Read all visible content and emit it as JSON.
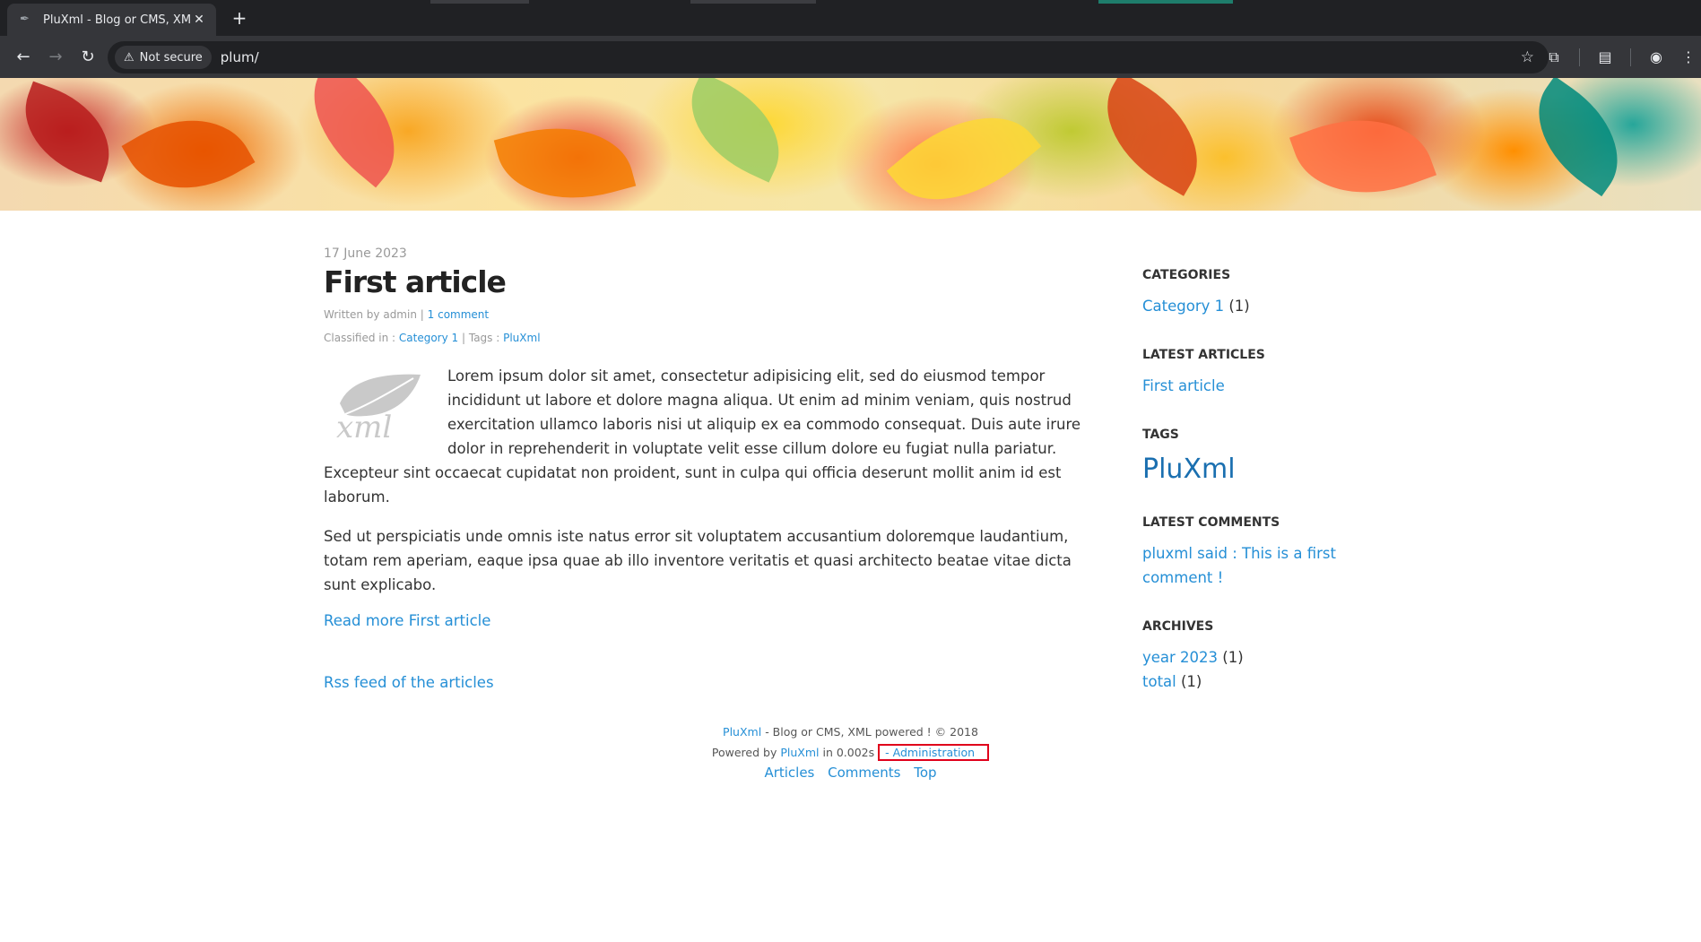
{
  "browser": {
    "tab_title": "PluXml - Blog or CMS, XML p",
    "security_label": "Not secure",
    "url": "plum/"
  },
  "article": {
    "date": "17 June 2023",
    "title": "First article",
    "written_by": "Written by admin",
    "comments_link": "1 comment",
    "classified_label": "Classified in :",
    "category_link": "Category 1",
    "tags_label": "| Tags :",
    "tag_link": "PluXml",
    "thumb_text": "xml",
    "paragraph1": "Lorem ipsum dolor sit amet, consectetur adipisicing elit, sed do eiusmod tempor incididunt ut labore et dolore magna aliqua. Ut enim ad minim veniam, quis nostrud exercitation ullamco laboris nisi ut aliquip ex ea commodo consequat. Duis aute irure dolor in reprehenderit in voluptate velit esse cillum dolore eu fugiat nulla pariatur. Excepteur sint occaecat cupidatat non proident, sunt in culpa qui officia deserunt mollit anim id est laborum.",
    "paragraph2": "Sed ut perspiciatis unde omnis iste natus error sit voluptatem accusantium doloremque laudantium, totam rem aperiam, eaque ipsa quae ab illo inventore veritatis et quasi architecto beatae vitae dicta sunt explicabo.",
    "read_more": "Read more First article",
    "rss": "Rss feed of the articles"
  },
  "sidebar": {
    "categories": {
      "title": "CATEGORIES",
      "item_link": "Category 1",
      "item_count": "(1)"
    },
    "latest_articles": {
      "title": "LATEST ARTICLES",
      "item_link": "First article"
    },
    "tags": {
      "title": "TAGS",
      "item_link": "PluXml"
    },
    "latest_comments": {
      "title": "LATEST COMMENTS",
      "item_link": "pluxml said : This is a first comment !"
    },
    "archives": {
      "title": "ARCHIVES",
      "year_link": "year 2023",
      "year_count": "(1)",
      "total_link": "total",
      "total_count": "(1)"
    }
  },
  "footer": {
    "brand_link": "PluXml",
    "tagline": "- Blog or CMS, XML powered ! © 2018",
    "powered_by": "Powered by",
    "powered_link": "PluXml",
    "timing": "in 0.002s",
    "admin_link": "- Administration",
    "nav": {
      "articles": "Articles",
      "comments": "Comments",
      "top": "Top"
    }
  }
}
